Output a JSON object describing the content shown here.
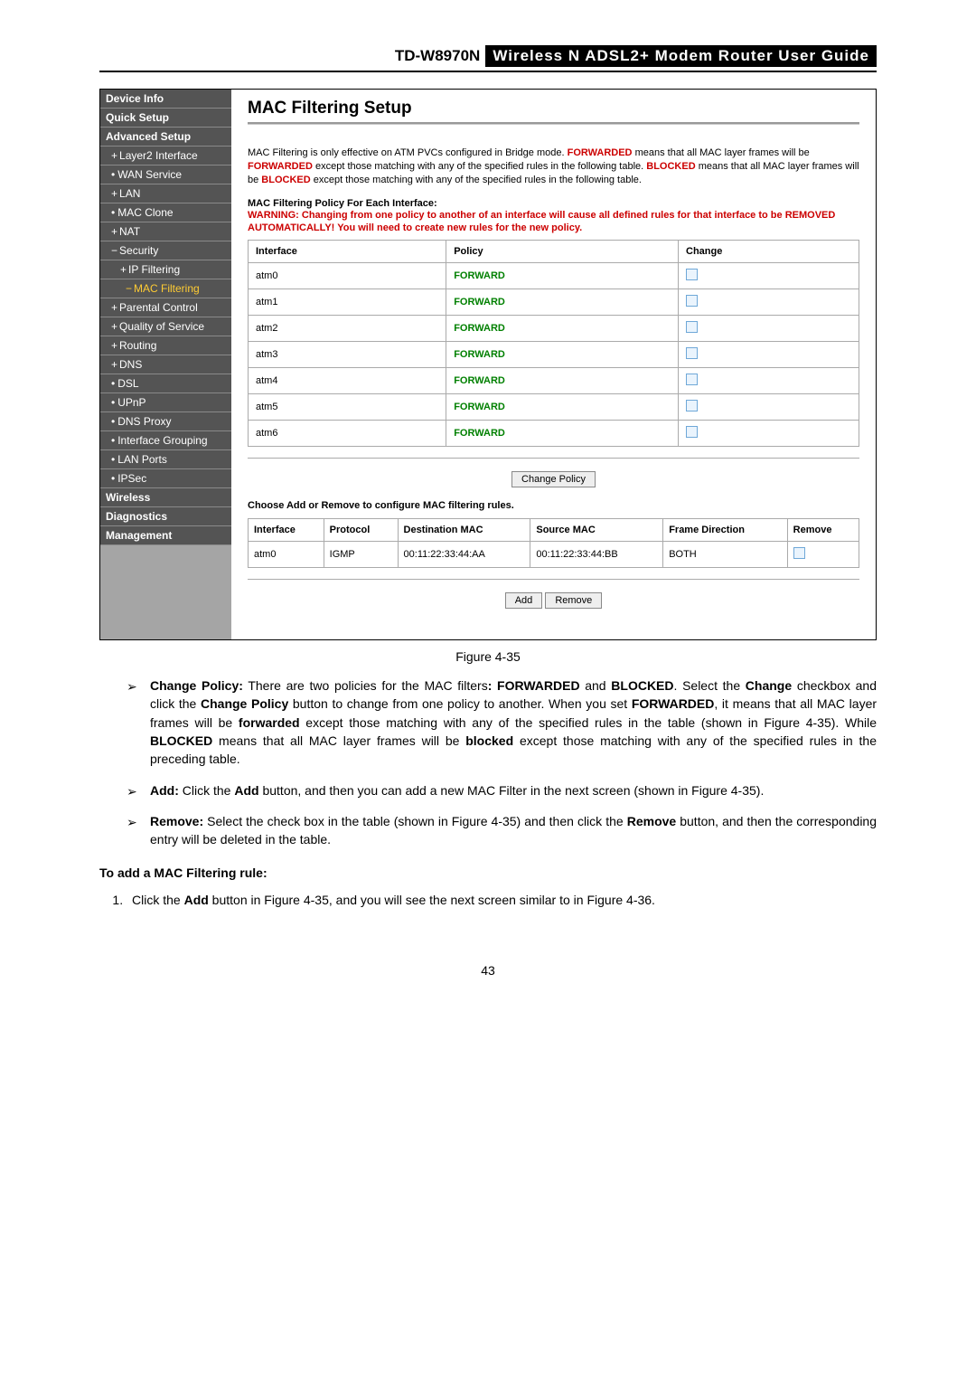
{
  "header": {
    "model": "TD-W8970N",
    "title": "Wireless  N  ADSL2+  Modem  Router  User  Guide"
  },
  "sidebar": {
    "items": [
      {
        "label": "Device Info",
        "cls": "side-item"
      },
      {
        "label": "Quick Setup",
        "cls": "side-item"
      },
      {
        "label": "Advanced Setup",
        "cls": "side-item"
      },
      {
        "label": "Layer2 Interface",
        "cls": "side-sub",
        "pre": "plus"
      },
      {
        "label": "WAN Service",
        "cls": "side-sub",
        "pre": "bullet"
      },
      {
        "label": "LAN",
        "cls": "side-sub",
        "pre": "plus"
      },
      {
        "label": "MAC Clone",
        "cls": "side-sub",
        "pre": "bullet"
      },
      {
        "label": "NAT",
        "cls": "side-sub",
        "pre": "plus"
      },
      {
        "label": "Security",
        "cls": "side-sub",
        "pre": "minus"
      },
      {
        "label": "IP Filtering",
        "cls": "side-sub side-sub2",
        "pre": "plus"
      },
      {
        "label": "MAC Filtering",
        "cls": "side-sub side-sub3",
        "pre": "minus",
        "hl": true
      },
      {
        "label": "Parental Control",
        "cls": "side-sub",
        "pre": "plus"
      },
      {
        "label": "Quality of Service",
        "cls": "side-sub",
        "pre": "plus"
      },
      {
        "label": "Routing",
        "cls": "side-sub",
        "pre": "plus"
      },
      {
        "label": "DNS",
        "cls": "side-sub",
        "pre": "plus"
      },
      {
        "label": "DSL",
        "cls": "side-sub",
        "pre": "bullet"
      },
      {
        "label": "UPnP",
        "cls": "side-sub",
        "pre": "bullet"
      },
      {
        "label": "DNS Proxy",
        "cls": "side-sub",
        "pre": "bullet"
      },
      {
        "label": "Interface Grouping",
        "cls": "side-sub",
        "pre": "bullet"
      },
      {
        "label": "LAN Ports",
        "cls": "side-sub",
        "pre": "bullet"
      },
      {
        "label": "IPSec",
        "cls": "side-sub",
        "pre": "bullet"
      },
      {
        "label": "Wireless",
        "cls": "side-item"
      },
      {
        "label": "Diagnostics",
        "cls": "side-item"
      },
      {
        "label": "Management",
        "cls": "side-item"
      }
    ]
  },
  "main": {
    "title": "MAC Filtering Setup",
    "info_pre": "MAC Filtering is only effective on ATM PVCs configured in Bridge mode. ",
    "info_fwd": "FORWARDED",
    "info_mid1": " means that all MAC layer frames will be ",
    "info_fwd2": "FORWARDED",
    "info_mid2": " except those matching with any of the specified rules in the following table. ",
    "info_blk": "BLOCKED",
    "info_mid3": " means that all MAC layer frames will be ",
    "info_blk2": "BLOCKED",
    "info_tail": " except those matching with any of the specified rules in the following table.",
    "policy_head": "MAC Filtering Policy For Each Interface:",
    "warning": "WARNING: Changing from one policy to another of an interface will cause all defined rules for that interface to be REMOVED AUTOMATICALLY! You will need to create new rules for the new policy.",
    "policy_table": {
      "h": [
        "Interface",
        "Policy",
        "Change"
      ],
      "rows": [
        {
          "if": "atm0",
          "pol": "FORWARD"
        },
        {
          "if": "atm1",
          "pol": "FORWARD"
        },
        {
          "if": "atm2",
          "pol": "FORWARD"
        },
        {
          "if": "atm3",
          "pol": "FORWARD"
        },
        {
          "if": "atm4",
          "pol": "FORWARD"
        },
        {
          "if": "atm5",
          "pol": "FORWARD"
        },
        {
          "if": "atm6",
          "pol": "FORWARD"
        }
      ]
    },
    "change_btn": "Change Policy",
    "choose_text": "Choose Add or Remove to configure MAC filtering rules.",
    "rules_table": {
      "h": [
        "Interface",
        "Protocol",
        "Destination MAC",
        "Source MAC",
        "Frame Direction",
        "Remove"
      ],
      "rows": [
        {
          "if": "atm0",
          "proto": "IGMP",
          "dst": "00:11:22:33:44:AA",
          "src": "00:11:22:33:44:BB",
          "dir": "BOTH"
        }
      ]
    },
    "add_btn": "Add",
    "remove_btn": "Remove"
  },
  "caption": "Figure 4-35",
  "bullets": {
    "b1_head": "Change Policy:",
    "b1_a": " There are two policies for the MAC filters",
    "b1_b": ": FORWARDED",
    "b1_c": " and ",
    "b1_d": "BLOCKED",
    "b1_e": ". Select the ",
    "b1_f": "Change",
    "b1_g": " checkbox and click the ",
    "b1_h": "Change Policy",
    "b1_i": " button to change from one policy to another. When you set ",
    "b1_j": "FORWARDED",
    "b1_k": ", it means that all MAC layer frames will be ",
    "b1_l": "forwarded",
    "b1_m": " except those matching with any of the specified rules in the table (shown in Figure 4-35). While ",
    "b1_n": "BLOCKED",
    "b1_o": " means that all MAC layer frames will be ",
    "b1_p": "blocked",
    "b1_q": " except those matching with any of the specified rules in the preceding table.",
    "b2_head": "Add:",
    "b2_a": " Click the ",
    "b2_b": "Add",
    "b2_c": " button, and then you can add a new MAC Filter in the next screen (shown in Figure 4-35).",
    "b3_head": "Remove:",
    "b3_a": " Select the check box in the table (shown in Figure 4-35) and then click the ",
    "b3_b": "Remove",
    "b3_c": " button, and then the corresponding entry will be deleted in the table."
  },
  "section_head": "To add a MAC Filtering rule:",
  "ol1_a": "Click the ",
  "ol1_b": "Add",
  "ol1_c": " button in Figure 4-35, and you will see the next screen similar to in Figure 4-36.",
  "page_num": "43"
}
